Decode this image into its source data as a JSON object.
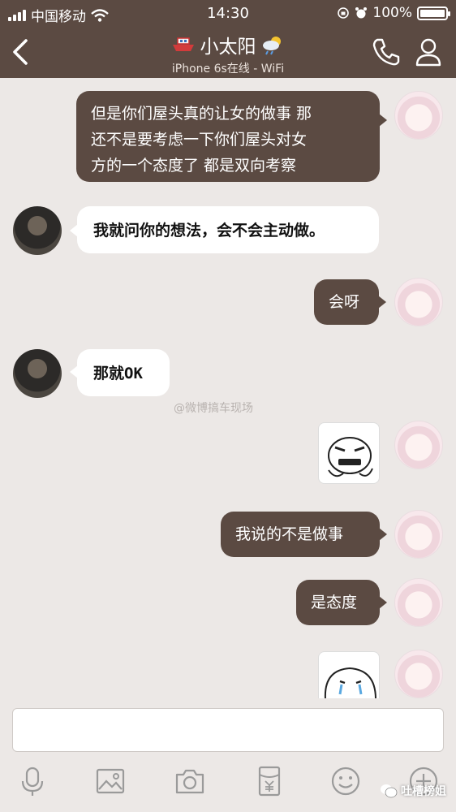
{
  "status_bar": {
    "carrier": "中国移动",
    "time": "14:30",
    "battery": "100%",
    "battery_level": 1.0
  },
  "header": {
    "title": "小太阳",
    "subtitle": "iPhone 6s在线 - WiFi"
  },
  "messages": [
    {
      "from": "me",
      "text_line1": "但是你们屋头真的让女的做事 那",
      "text_line2": "还不是要考虑一下你们屋头对女",
      "text_line3": "方的一个态度了 都是双向考察"
    },
    {
      "from": "other",
      "text": "我就问你的想法，会不会主动做。"
    },
    {
      "from": "me",
      "text": "会呀"
    },
    {
      "from": "other",
      "text": "那就OK"
    },
    {
      "from": "me",
      "type": "sticker"
    },
    {
      "from": "me",
      "text": "我说的不是做事"
    },
    {
      "from": "me",
      "text": "是态度"
    },
    {
      "from": "me",
      "type": "sticker"
    }
  ],
  "watermark": "@微博搞车现场",
  "toolbar": {
    "icons": [
      "microphone-icon",
      "image-icon",
      "camera-icon",
      "red-packet-icon",
      "emoji-icon",
      "plus-icon"
    ]
  },
  "brand": "吐槽榜姐"
}
